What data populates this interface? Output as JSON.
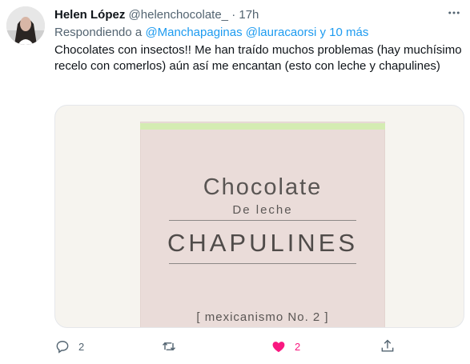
{
  "tweet": {
    "display_name": "Helen López",
    "handle": "@helenchocolate_",
    "dot": "·",
    "time": "17h",
    "reply": {
      "prefix": "Respondiendo a",
      "mentions": "@Manchapaginas @lauracaorsi y 10 más"
    },
    "text": "Chocolates con insectos!!  Me han traído muchos problemas (hay muchísimo recelo con comerlos) aún así me encantan (esto con leche y chapulines)",
    "media": {
      "line1": "Chocolate",
      "line2": "De leche",
      "line3": "CHAPULINES",
      "line4": "[ mexicanismo No. 2 ]"
    },
    "actions": {
      "reply_count": "2",
      "retweet_count": "",
      "like_count": "2"
    }
  },
  "colors": {
    "accent": "#1d9bf0",
    "like": "#f91880",
    "muted": "#536471",
    "package": "#eadcd9",
    "strip": "#d4ecb2"
  },
  "icons": [
    "avatar",
    "more-icon",
    "reply-icon",
    "retweet-icon",
    "heart-icon",
    "share-icon"
  ]
}
